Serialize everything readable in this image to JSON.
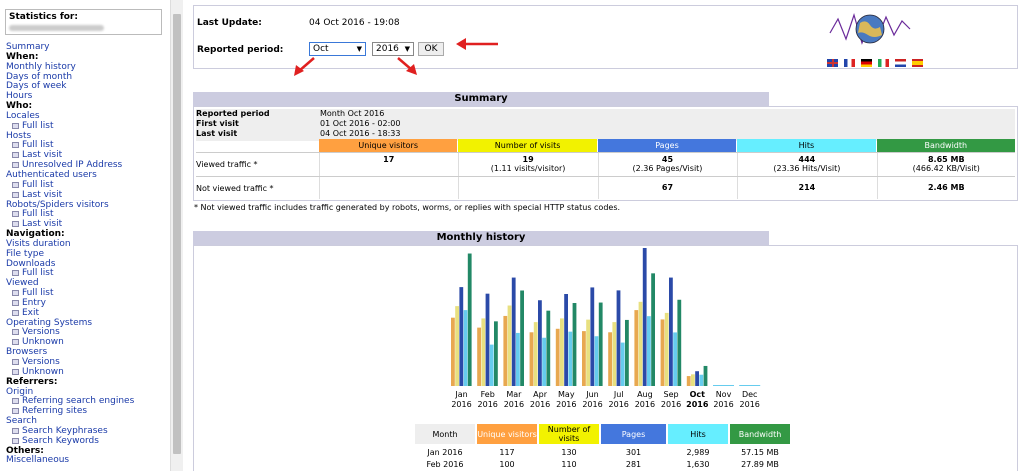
{
  "sidebar": {
    "stats_for": "Statistics for:",
    "nav": [
      {
        "t": "Summary",
        "k": "link"
      },
      {
        "t": "When:",
        "k": "head"
      },
      {
        "t": "Monthly history",
        "k": "link"
      },
      {
        "t": "Days of month",
        "k": "link"
      },
      {
        "t": "Days of week",
        "k": "link"
      },
      {
        "t": "Hours",
        "k": "link"
      },
      {
        "t": "Who:",
        "k": "head"
      },
      {
        "t": "Locales",
        "k": "link"
      },
      {
        "t": "Full list",
        "k": "sub"
      },
      {
        "t": "Hosts",
        "k": "link"
      },
      {
        "t": "Full list",
        "k": "sub"
      },
      {
        "t": "Last visit",
        "k": "sub"
      },
      {
        "t": "Unresolved IP Address",
        "k": "sub"
      },
      {
        "t": "Authenticated users",
        "k": "link"
      },
      {
        "t": "Full list",
        "k": "sub"
      },
      {
        "t": "Last visit",
        "k": "sub"
      },
      {
        "t": "Robots/Spiders visitors",
        "k": "link"
      },
      {
        "t": "Full list",
        "k": "sub"
      },
      {
        "t": "Last visit",
        "k": "sub"
      },
      {
        "t": "Navigation:",
        "k": "head"
      },
      {
        "t": "Visits duration",
        "k": "link"
      },
      {
        "t": "File type",
        "k": "link"
      },
      {
        "t": "Downloads",
        "k": "link"
      },
      {
        "t": "Full list",
        "k": "sub"
      },
      {
        "t": "Viewed",
        "k": "link"
      },
      {
        "t": "Full list",
        "k": "sub"
      },
      {
        "t": "Entry",
        "k": "sub"
      },
      {
        "t": "Exit",
        "k": "sub"
      },
      {
        "t": "Operating Systems",
        "k": "link"
      },
      {
        "t": "Versions",
        "k": "sub"
      },
      {
        "t": "Unknown",
        "k": "sub"
      },
      {
        "t": "Browsers",
        "k": "link"
      },
      {
        "t": "Versions",
        "k": "sub"
      },
      {
        "t": "Unknown",
        "k": "sub"
      },
      {
        "t": "Referrers:",
        "k": "head"
      },
      {
        "t": "Origin",
        "k": "link"
      },
      {
        "t": "Referring search engines",
        "k": "sub"
      },
      {
        "t": "Referring sites",
        "k": "sub"
      },
      {
        "t": "Search",
        "k": "link"
      },
      {
        "t": "Search Keyphrases",
        "k": "sub"
      },
      {
        "t": "Search Keywords",
        "k": "sub"
      },
      {
        "t": "Others:",
        "k": "head"
      },
      {
        "t": "Miscellaneous",
        "k": "link"
      }
    ]
  },
  "header": {
    "last_update_label": "Last Update:",
    "last_update_value": "04 Oct 2016 - 19:08",
    "reported_period_label": "Reported period:",
    "month_selected": "Oct",
    "year_selected": "2016",
    "ok_label": "OK",
    "flags": [
      "en",
      "fr",
      "de",
      "it",
      "nl",
      "es"
    ]
  },
  "summary": {
    "title": "Summary",
    "rp_label": "Reported period",
    "rp_value": "Month Oct 2016",
    "first_label": "First visit",
    "first_value": "01 Oct 2016 - 02:00",
    "last_label": "Last visit",
    "last_value": "04 Oct 2016 - 18:33",
    "cols": [
      "Unique visitors",
      "Number of visits",
      "Pages",
      "Hits",
      "Bandwidth"
    ],
    "col_colors": [
      "#ffa040",
      "#f2f200",
      "#4477dd",
      "#66eeff",
      "#339944"
    ],
    "viewed_label": "Viewed traffic *",
    "viewed": [
      "17",
      "19",
      "45",
      "444",
      "8.65 MB"
    ],
    "viewed_sub": [
      "",
      "(1.11 visits/visitor)",
      "(2.36 Pages/Visit)",
      "(23.36 Hits/Visit)",
      "(466.42 KB/Visit)"
    ],
    "notviewed_label": "Not viewed traffic *",
    "notviewed": [
      "",
      "",
      "67",
      "214",
      "2.46 MB"
    ],
    "footnote": "* Not viewed traffic includes traffic generated by robots, worms, or replies with special HTTP status codes."
  },
  "monthly": {
    "title": "Monthly history",
    "table_head": [
      "Month",
      "Unique visitors",
      "Number of visits",
      "Pages",
      "Hits",
      "Bandwidth"
    ],
    "rows": [
      [
        "Jan 2016",
        "117",
        "130",
        "301",
        "2,989",
        "57.15 MB"
      ],
      [
        "Feb 2016",
        "100",
        "110",
        "281",
        "1,630",
        "27.89 MB"
      ]
    ]
  },
  "chart_data": {
    "type": "bar",
    "categories": [
      "Jan 2016",
      "Feb 2016",
      "Mar 2016",
      "Apr 2016",
      "May 2016",
      "Jun 2016",
      "Jul 2016",
      "Aug 2016",
      "Sep 2016",
      "Oct 2016",
      "Nov 2016",
      "Dec 2016"
    ],
    "month_labels": [
      "Jan",
      "Feb",
      "Mar",
      "Apr",
      "May",
      "Jun",
      "Jul",
      "Aug",
      "Sep",
      "Oct",
      "Nov",
      "Dec"
    ],
    "year_labels": [
      "2016",
      "2016",
      "2016",
      "2016",
      "2016",
      "2016",
      "2016",
      "2016",
      "2016",
      "2016",
      "2016",
      "2016"
    ],
    "current_index": 9,
    "series": [
      {
        "name": "Unique visitors",
        "color": "#e8a850",
        "values": [
          117,
          100,
          120,
          92,
          98,
          94,
          92,
          130,
          114,
          17,
          0,
          0
        ]
      },
      {
        "name": "Number of visits",
        "color": "#e8e080",
        "values": [
          130,
          110,
          131,
          104,
          110,
          108,
          104,
          137,
          119,
          19,
          0,
          0
        ]
      },
      {
        "name": "Pages",
        "color": "#2b4aa8",
        "values": [
          301,
          281,
          330,
          261,
          280,
          300,
          291,
          420,
          330,
          45,
          0,
          0
        ]
      },
      {
        "name": "Hits",
        "color": "#66ccee",
        "values": [
          2989,
          1630,
          2090,
          1900,
          2140,
          1960,
          1710,
          2750,
          2110,
          444,
          0,
          0
        ]
      },
      {
        "name": "Bandwidth",
        "color": "#228866",
        "values": [
          57.15,
          27.89,
          41.2,
          32.5,
          35.8,
          36.0,
          28.5,
          48.6,
          37.2,
          8.65,
          0,
          0
        ]
      }
    ]
  }
}
